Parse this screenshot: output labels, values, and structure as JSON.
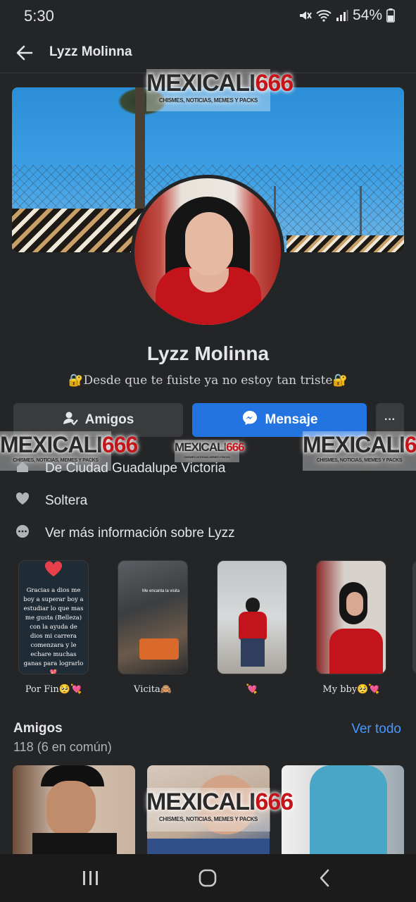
{
  "status_bar": {
    "time": "5:30",
    "battery": "54%"
  },
  "nav": {
    "title": "Lyzz Molinna"
  },
  "watermark": {
    "title": "MEXICALI",
    "number": "666",
    "subtitle": "CHISMES, NOTICIAS, MEMES Y PACKS"
  },
  "profile": {
    "name": "Lyzz Molinna",
    "bio": "🔐Desde que te fuiste ya no estoy tan triste🔐"
  },
  "actions": {
    "friends": "Amigos",
    "message": "Mensaje",
    "more": "···"
  },
  "info": {
    "hometown": "De Ciudad Guadalupe Victoria",
    "relationship": "Soltera",
    "more": "Ver más información sobre Lyzz"
  },
  "highlights": [
    {
      "label": "Por Fin🥺💘",
      "text": "Gracias a dios me boy a superar boy a estudiar lo que mas me gusta (Belleza) con la ayuda de dios mi carrera comenzara y le echare muchas ganas para lograrlo💖"
    },
    {
      "label": "Vicita🙈",
      "text": "Me encanta la visita"
    },
    {
      "label": "💘",
      "text": ""
    },
    {
      "label": "My bby🥺💘",
      "text": ""
    }
  ],
  "friends": {
    "title": "Amigos",
    "see_all": "Ver todo",
    "count": "118 (6 en común)"
  },
  "colors": {
    "background": "#242527",
    "accent": "#2374e1",
    "link": "#4599ff",
    "secondary_button": "#3a3b3c"
  }
}
